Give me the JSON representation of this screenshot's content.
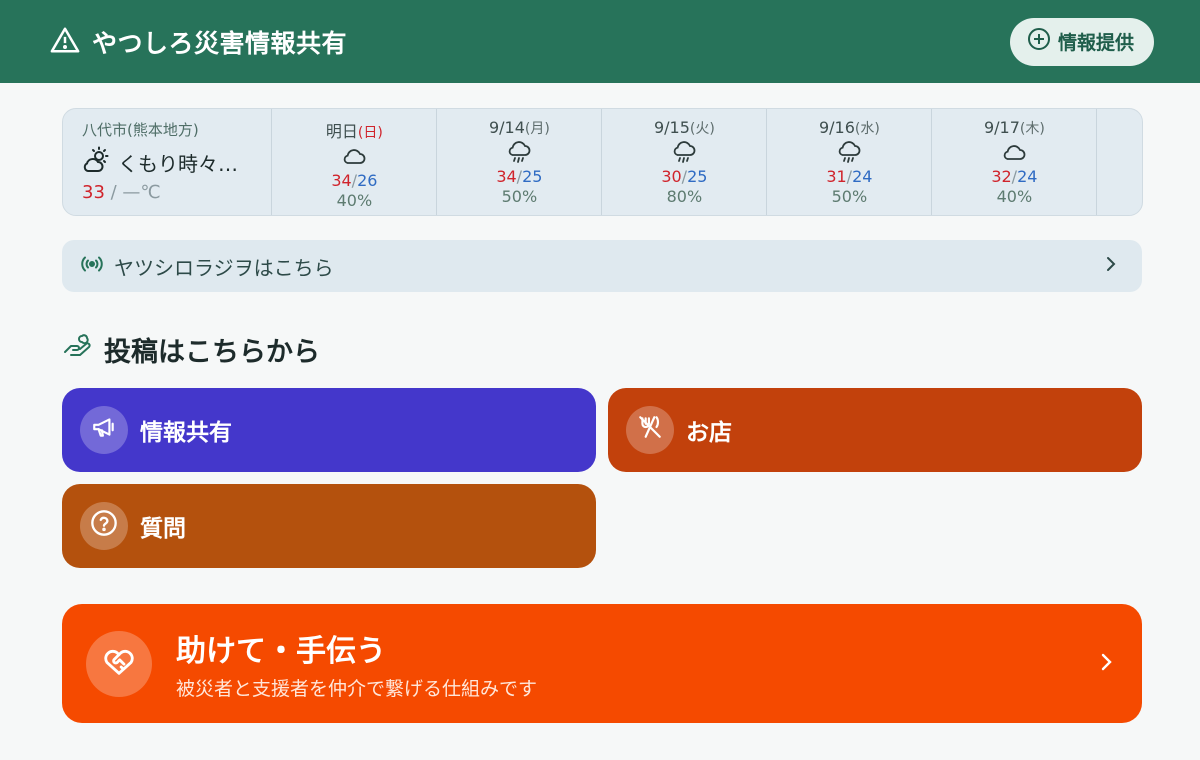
{
  "header": {
    "title": "やつしろ災害情報共有",
    "provide_label": "情報提供"
  },
  "weather": {
    "location": "八代市(熊本地方)",
    "now_text": "くもり時々…",
    "now_high": "33",
    "now_rest": " / —℃",
    "days": [
      {
        "date": "明日",
        "dow": "(日)",
        "dow_red": true,
        "icon": "cloud",
        "high": "34",
        "low": "26",
        "pop": "40%"
      },
      {
        "date": "9/14",
        "dow": "(月)",
        "dow_red": false,
        "icon": "rain",
        "high": "34",
        "low": "25",
        "pop": "50%"
      },
      {
        "date": "9/15",
        "dow": "(火)",
        "dow_red": false,
        "icon": "rain",
        "high": "30",
        "low": "25",
        "pop": "80%"
      },
      {
        "date": "9/16",
        "dow": "(水)",
        "dow_red": false,
        "icon": "rain",
        "high": "31",
        "low": "24",
        "pop": "50%"
      },
      {
        "date": "9/17",
        "dow": "(木)",
        "dow_red": false,
        "icon": "cloud",
        "high": "32",
        "low": "24",
        "pop": "40%"
      }
    ]
  },
  "radio": {
    "label": "ヤツシロラジヲはこちら"
  },
  "post_section": {
    "title": "投稿はこちらから",
    "buttons": {
      "info": "情報共有",
      "shop": "お店",
      "question": "質問"
    }
  },
  "help": {
    "title": "助けて・手伝う",
    "subtitle": "被災者と支援者を仲介で繋げる仕組みです"
  },
  "colors": {
    "header": "#27735a",
    "info": "#4437cb",
    "shop": "#c2410c",
    "question": "#b4510d",
    "help": "#f54a00",
    "temp_high": "#d0242c",
    "temp_low": "#2f6bc3"
  }
}
